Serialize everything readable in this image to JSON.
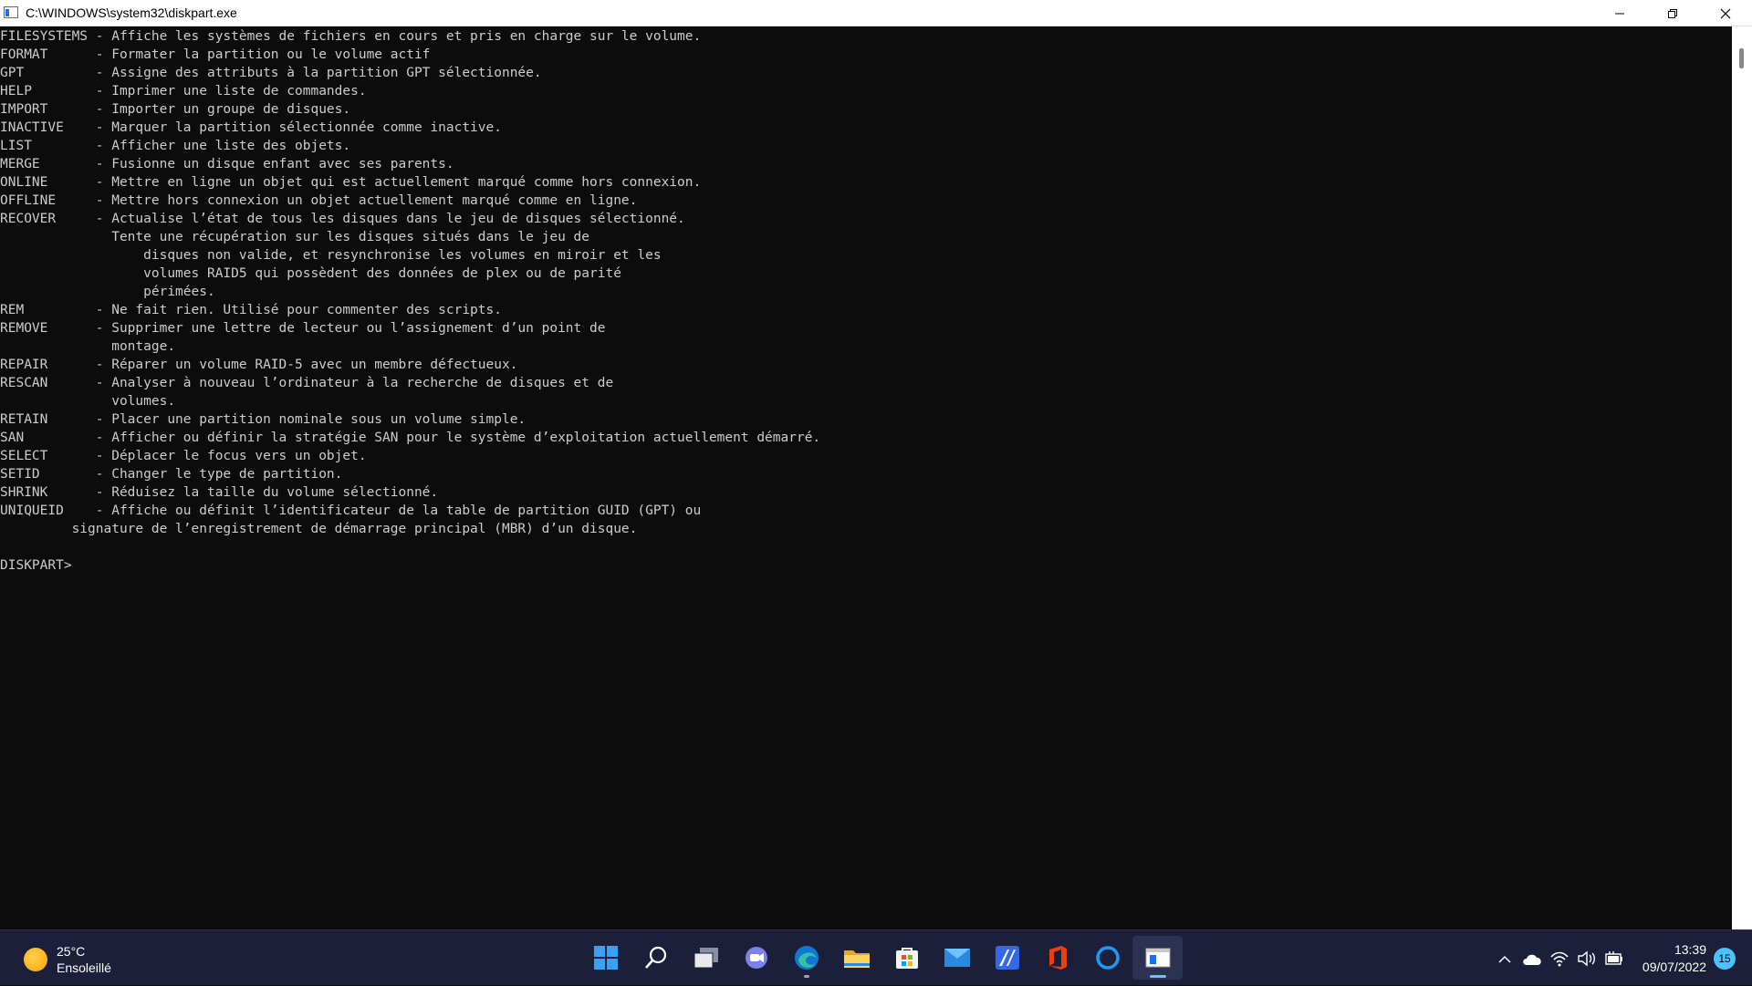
{
  "window": {
    "title": "C:\\WINDOWS\\system32\\diskpart.exe"
  },
  "console": {
    "lines": [
      "FILESYSTEMS - Affiche les systèmes de fichiers en cours et pris en charge sur le volume.",
      "FORMAT      - Formater la partition ou le volume actif",
      "GPT         - Assigne des attributs à la partition GPT sélectionnée.",
      "HELP        - Imprimer une liste de commandes.",
      "IMPORT      - Importer un groupe de disques.",
      "INACTIVE    - Marquer la partition sélectionnée comme inactive.",
      "LIST        - Afficher une liste des objets.",
      "MERGE       - Fusionne un disque enfant avec ses parents.",
      "ONLINE      - Mettre en ligne un objet qui est actuellement marqué comme hors connexion.",
      "OFFLINE     - Mettre hors connexion un objet actuellement marqué comme en ligne.",
      "RECOVER     - Actualise l’état de tous les disques dans le jeu de disques sélectionné.",
      "              Tente une récupération sur les disques situés dans le jeu de",
      "                  disques non valide, et resynchronise les volumes en miroir et les",
      "                  volumes RAID5 qui possèdent des données de plex ou de parité",
      "                  périmées.",
      "REM         - Ne fait rien. Utilisé pour commenter des scripts.",
      "REMOVE      - Supprimer une lettre de lecteur ou l’assignement d’un point de",
      "              montage.",
      "REPAIR      - Réparer un volume RAID-5 avec un membre défectueux.",
      "RESCAN      - Analyser à nouveau l’ordinateur à la recherche de disques et de",
      "              volumes.",
      "RETAIN      - Placer une partition nominale sous un volume simple.",
      "SAN         - Afficher ou définir la stratégie SAN pour le système d’exploitation actuellement démarré.",
      "SELECT      - Déplacer le focus vers un objet.",
      "SETID       - Changer le type de partition.",
      "SHRINK      - Réduisez la taille du volume sélectionné.",
      "UNIQUEID    - Affiche ou définit l’identificateur de la table de partition GUID (GPT) ou",
      "         signature de l’enregistrement de démarrage principal (MBR) d’un disque.",
      "",
      "DISKPART>"
    ]
  },
  "taskbar": {
    "weather": {
      "temperature": "25°C",
      "condition": "Ensoleillé"
    },
    "apps": [
      {
        "name": "start",
        "icon": "windows-logo-icon"
      },
      {
        "name": "search",
        "icon": "search-icon"
      },
      {
        "name": "task-view",
        "icon": "task-view-icon"
      },
      {
        "name": "chat",
        "icon": "chat-icon"
      },
      {
        "name": "edge",
        "icon": "edge-icon"
      },
      {
        "name": "file-explorer",
        "icon": "folder-icon"
      },
      {
        "name": "store",
        "icon": "store-icon"
      },
      {
        "name": "mail",
        "icon": "mail-icon"
      },
      {
        "name": "app-blue",
        "icon": "app-icon"
      },
      {
        "name": "office",
        "icon": "office-icon"
      },
      {
        "name": "cortana",
        "icon": "cortana-icon"
      },
      {
        "name": "diskpart",
        "icon": "console-icon"
      }
    ],
    "clock": {
      "time": "13:39",
      "date": "09/07/2022"
    },
    "notifications": "15"
  },
  "colors": {
    "console_bg": "#0c0c0c",
    "console_fg": "#cccccc",
    "taskbar_bg": "#1c1f3a",
    "accent": "#4cc2ff"
  }
}
